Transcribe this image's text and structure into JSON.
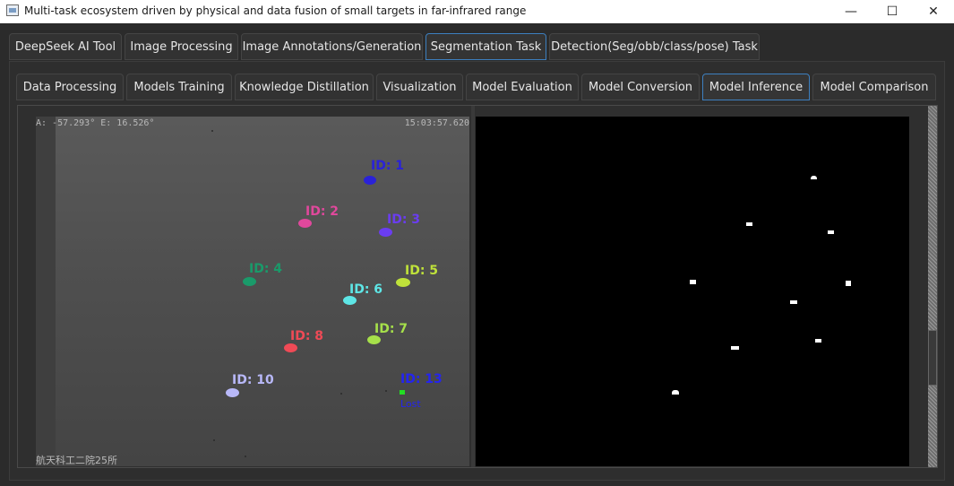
{
  "window": {
    "title": "Multi-task ecosystem driven by physical and data fusion of small targets in far-infrared range",
    "minimize": "—",
    "maximize": "☐",
    "close": "✕"
  },
  "main_tabs": [
    {
      "label": "DeepSeek AI Tool"
    },
    {
      "label": "Image Processing"
    },
    {
      "label": "Image Annotations/Generation"
    },
    {
      "label": "Segmentation Task"
    },
    {
      "label": "Detection(Seg/obb/class/pose) Task"
    }
  ],
  "sub_tabs": [
    {
      "label": "Data Processing"
    },
    {
      "label": "Models Training"
    },
    {
      "label": "Knowledge Distillation"
    },
    {
      "label": "Visualization"
    },
    {
      "label": "Model Evaluation"
    },
    {
      "label": "Model Conversion"
    },
    {
      "label": "Model Inference"
    },
    {
      "label": "Model Comparison"
    }
  ],
  "left_image": {
    "coords": "A: -57.293°  E:  16.526°",
    "timestamp": "15:03:57.620",
    "watermark": "航天科工二院25所",
    "targets": [
      {
        "label": "ID: 1",
        "color": "#2a22d8"
      },
      {
        "label": "ID: 2",
        "color": "#e0489c"
      },
      {
        "label": "ID: 3",
        "color": "#6a3df0"
      },
      {
        "label": "ID: 4",
        "color": "#1a9a6a"
      },
      {
        "label": "ID: 5",
        "color": "#bfe23a"
      },
      {
        "label": "ID: 6",
        "color": "#5ee6e6"
      },
      {
        "label": "ID: 7",
        "color": "#a6e04a"
      },
      {
        "label": "ID: 8",
        "color": "#f04a56"
      },
      {
        "label": "ID: 10",
        "color": "#b8b8f8"
      },
      {
        "label": "ID: 13",
        "color": "#2424f0"
      }
    ],
    "lost_label": "Lost",
    "lost_color": "#22dd22"
  }
}
